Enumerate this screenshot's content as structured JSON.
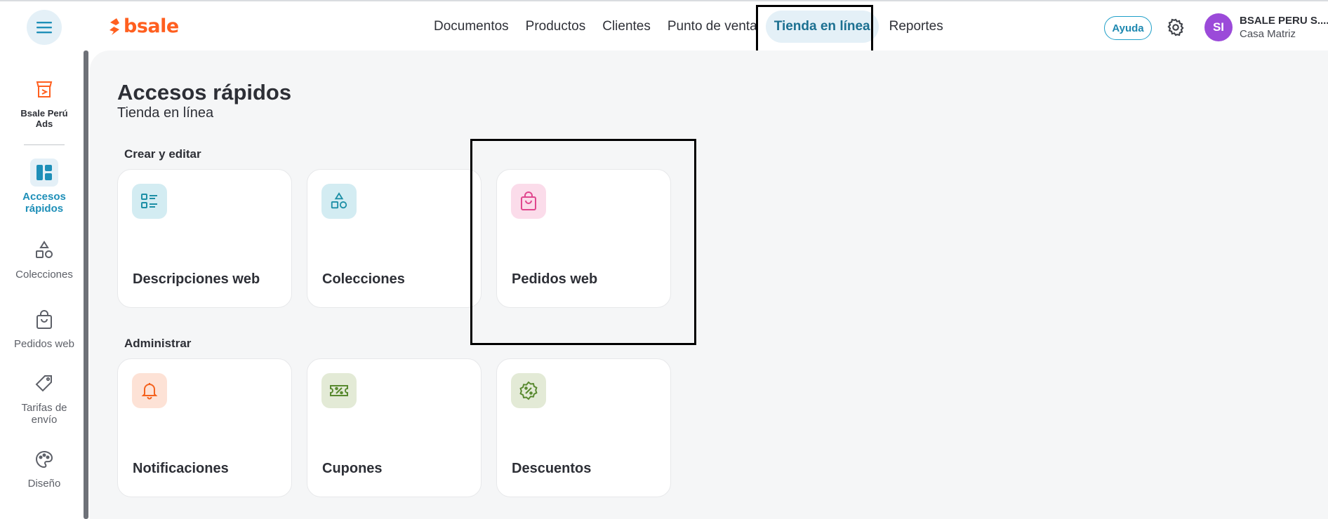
{
  "app": {
    "brand": "bsale"
  },
  "header": {
    "nav": [
      {
        "label": "Documentos",
        "active": false
      },
      {
        "label": "Productos",
        "active": false
      },
      {
        "label": "Clientes",
        "active": false
      },
      {
        "label": "Punto de venta",
        "active": false
      },
      {
        "label": "Tienda en línea",
        "active": true
      },
      {
        "label": "Reportes",
        "active": false
      }
    ],
    "help_label": "Ayuda",
    "user": {
      "initials": "SI",
      "name": "BSALE PERU S....",
      "branch": "Casa Matriz",
      "avatar_color": "#9b4ad9"
    }
  },
  "sidebar": {
    "items": [
      {
        "label": "Bsale Perú Ads",
        "icon": "store-ads-icon"
      },
      {
        "label": "Accesos rápidos",
        "icon": "dashboard-icon",
        "active": true
      },
      {
        "label": "Colecciones",
        "icon": "shapes-icon"
      },
      {
        "label": "Pedidos web",
        "icon": "shopping-bag-icon"
      },
      {
        "label": "Tarifas de envío",
        "icon": "tag-icon"
      },
      {
        "label": "Diseño",
        "icon": "palette-icon"
      }
    ]
  },
  "main": {
    "title": "Accesos rápidos",
    "subtitle": "Tienda en línea",
    "sections": [
      {
        "title": "Crear y editar",
        "cards": [
          {
            "label": "Descripciones web",
            "icon": "list-icon",
            "icon_bg": "#d3ecf2",
            "icon_color": "#1d8fa6"
          },
          {
            "label": "Colecciones",
            "icon": "shapes-icon",
            "icon_bg": "#d3ecf2",
            "icon_color": "#1d8fa6"
          },
          {
            "label": "Pedidos web",
            "icon": "shopping-bag-icon",
            "icon_bg": "#fbdcea",
            "icon_color": "#e0478e"
          }
        ]
      },
      {
        "title": "Administrar",
        "cards": [
          {
            "label": "Notificaciones",
            "icon": "bell-icon",
            "icon_bg": "#fde2d6",
            "icon_color": "#f4621e"
          },
          {
            "label": "Cupones",
            "icon": "coupon-icon",
            "icon_bg": "#e3ead6",
            "icon_color": "#58892f"
          },
          {
            "label": "Descuentos",
            "icon": "discount-badge-icon",
            "icon_bg": "#e3ead6",
            "icon_color": "#58892f"
          }
        ]
      }
    ]
  },
  "colors": {
    "brand": "#ff5f1f",
    "accent": "#1e8fb8",
    "nav_active_bg": "#e4f0f7"
  }
}
